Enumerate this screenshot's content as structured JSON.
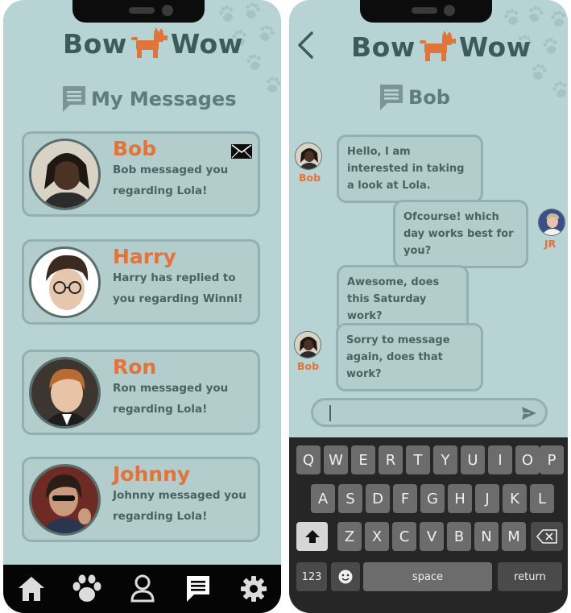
{
  "app": {
    "brand_left": "Bow",
    "brand_right": "Wow"
  },
  "messages_screen": {
    "title": "My Messages",
    "conversations": [
      {
        "name": "Bob",
        "preview": "Bob messaged you regarding Lola!",
        "unread": true
      },
      {
        "name": "Harry",
        "preview": "Harry has replied to you regarding Winni!"
      },
      {
        "name": "Ron",
        "preview": "Ron messaged you regarding Lola!"
      },
      {
        "name": "Johnny",
        "preview": "Johnny messaged you regarding Lola!"
      }
    ],
    "nav": [
      {
        "icon": "home-icon"
      },
      {
        "icon": "paw-icon"
      },
      {
        "icon": "user-icon"
      },
      {
        "icon": "chat-icon",
        "active": true
      },
      {
        "icon": "gear-icon"
      }
    ]
  },
  "chat_screen": {
    "title": "Bob",
    "messages": [
      {
        "from": "Bob",
        "text": "Hello, I am interested in taking a look at Lola."
      },
      {
        "from": "JR",
        "text": "Ofcourse! which day works best for you?"
      },
      {
        "from": "Bob",
        "text": "Awesome, does this Saturday work?"
      },
      {
        "from": "Bob",
        "text": "Sorry to message again, does that work?"
      }
    ],
    "input_value": ""
  },
  "keyboard": {
    "row1": [
      "Q",
      "W",
      "E",
      "R",
      "T",
      "Y",
      "U",
      "I",
      "O",
      "P"
    ],
    "row2": [
      "A",
      "S",
      "D",
      "F",
      "G",
      "H",
      "J",
      "K",
      "L"
    ],
    "row3": [
      "Z",
      "X",
      "C",
      "V",
      "B",
      "N",
      "M"
    ],
    "numbers_label": "123",
    "space_label": "space",
    "return_label": "return"
  },
  "colors": {
    "accent": "#e0743a",
    "background": "#b8d3d3",
    "card": "#b3cccc",
    "text": "#4a6262"
  }
}
